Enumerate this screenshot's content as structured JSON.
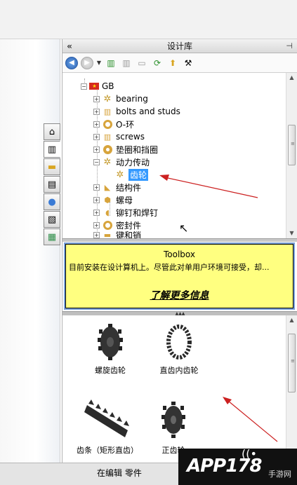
{
  "panel": {
    "title": "设计库",
    "collapse_glyph": "«",
    "pin_glyph": "⊣"
  },
  "toolbar": {
    "back_glyph": "◀",
    "forward_glyph": "▶",
    "dropdown_glyph": "▼"
  },
  "tree": {
    "root": "GB",
    "items": [
      {
        "label": "bearing",
        "icon": "gear-icon"
      },
      {
        "label": "bolts and studs",
        "icon": "bolt-icon"
      },
      {
        "label": "O-环",
        "icon": "ring-icon"
      },
      {
        "label": "screws",
        "icon": "bolt-icon"
      },
      {
        "label": "垫圈和挡圈",
        "icon": "ring-icon"
      },
      {
        "label": "动力传动",
        "icon": "gear-icon"
      },
      {
        "label": "齿轮",
        "icon": "gear-icon",
        "selected": true
      },
      {
        "label": "结构件",
        "icon": "beam-icon"
      },
      {
        "label": "螺母",
        "icon": "nut-icon"
      },
      {
        "label": "铆钉和焊钉",
        "icon": "rivet-icon"
      },
      {
        "label": "密封件",
        "icon": "ring-icon"
      },
      {
        "label": "键和销",
        "icon": "key-icon"
      }
    ],
    "expander_plus": "+",
    "expander_minus": "−"
  },
  "info": {
    "title": "Toolbox",
    "text": "目前安装在设计算机上。尽管此对单用户环境可接受，却...",
    "link": "了解更多信息"
  },
  "gallery": {
    "items": [
      {
        "label": "螺旋齿轮"
      },
      {
        "label": "直齿内齿轮"
      },
      {
        "label": "齿条（矩形直齿）"
      },
      {
        "label": "正齿轮"
      }
    ]
  },
  "status": {
    "text": "在编辑 零件"
  },
  "watermark": {
    "main": "APP178",
    "sub": "手游网"
  },
  "colors": {
    "selection": "#3399ff",
    "info_bg": "#ffff80",
    "arrow": "#cc2020"
  }
}
